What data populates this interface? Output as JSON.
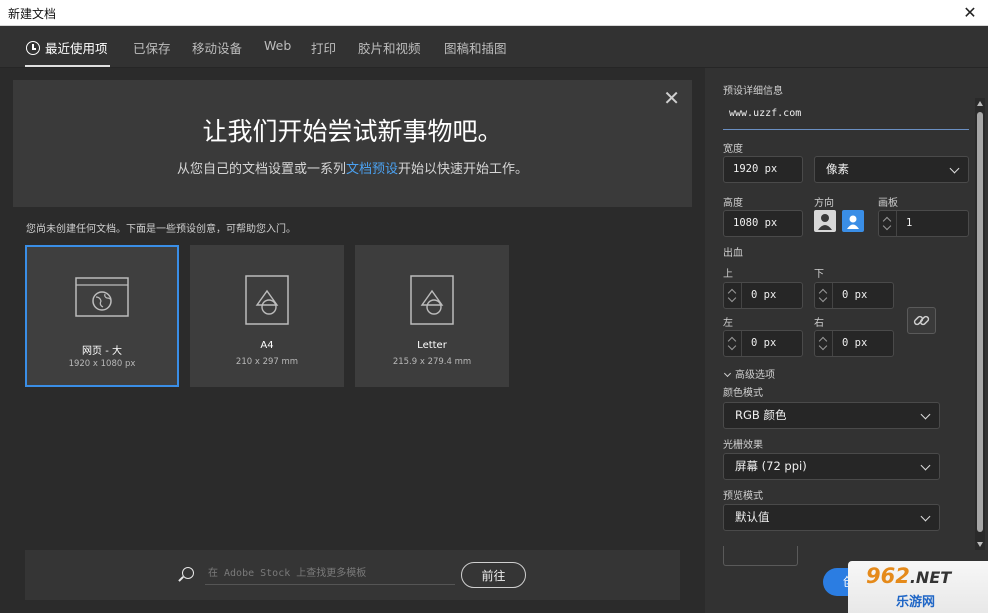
{
  "window": {
    "title": "新建文档",
    "close": "✕"
  },
  "tabs": [
    {
      "label": "最近使用项"
    },
    {
      "label": "已保存"
    },
    {
      "label": "移动设备"
    },
    {
      "label": "Web"
    },
    {
      "label": "打印"
    },
    {
      "label": "胶片和视频"
    },
    {
      "label": "图稿和插图"
    }
  ],
  "banner": {
    "headline": "让我们开始尝试新事物吧。",
    "sub_before": "从您自己的文档设置或一系列",
    "sub_link": "文档预设",
    "sub_after": "开始以快速开始工作。",
    "close": "✕"
  },
  "hint": "您尚未创建任何文档。下面是一些预设创意，可帮助您入门。",
  "presets": [
    {
      "name": "网页 - 大",
      "size": "1920 x 1080 px"
    },
    {
      "name": "A4",
      "size": "210 x 297 mm"
    },
    {
      "name": "Letter",
      "size": "215.9 x 279.4 mm"
    }
  ],
  "search": {
    "placeholder": "在 Adobe Stock 上查找更多模板",
    "go_label": "前往"
  },
  "details": {
    "section_title": "预设详细信息",
    "preset_name": "www.uzzf.com",
    "width_label": "宽度",
    "width_value": "1920 px",
    "unit": "像素",
    "height_label": "高度",
    "height_value": "1080 px",
    "orientation_label": "方向",
    "artboard_label": "画板",
    "artboard_value": "1",
    "bleed_label": "出血",
    "top_label": "上",
    "top_value": "0 px",
    "bottom_label": "下",
    "bottom_value": "0 px",
    "left_label": "左",
    "left_value": "0 px",
    "right_label": "右",
    "right_value": "0 px",
    "advanced_label": "高级选项",
    "color_mode_label": "颜色模式",
    "color_mode_value": "RGB 颜色",
    "raster_label": "光栅效果",
    "raster_value": "屏幕 (72 ppi)",
    "preview_label": "预览模式",
    "preview_value": "默认值",
    "create_label": "创建"
  },
  "watermark": {
    "top": "962",
    "net": ".NET",
    "bottom": "乐游网"
  },
  "colors": {
    "accent": "#2b7de2",
    "selection": "#3a8ee6",
    "link": "#4ba1f0"
  }
}
